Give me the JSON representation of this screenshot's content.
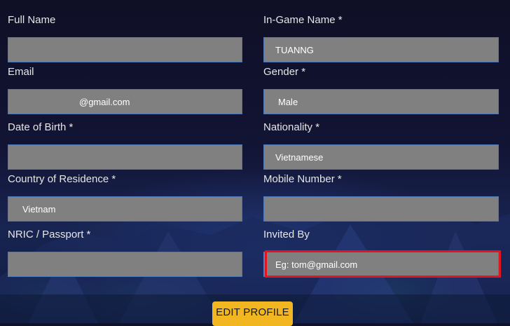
{
  "form": {
    "fields": [
      {
        "key": "full_name",
        "label": "Full Name",
        "value": ""
      },
      {
        "key": "ingame_name",
        "label": "In-Game Name *",
        "value": "TUANNG"
      },
      {
        "key": "email",
        "label": "Email",
        "value": "@gmail.com"
      },
      {
        "key": "gender",
        "label": "Gender *",
        "value": "Male"
      },
      {
        "key": "dob",
        "label": "Date of Birth *",
        "value": ""
      },
      {
        "key": "nationality",
        "label": "Nationality *",
        "value": "Vietnamese"
      },
      {
        "key": "country",
        "label": "Country of Residence *",
        "value": "Vietnam"
      },
      {
        "key": "mobile",
        "label": "Mobile Number *",
        "value": ""
      },
      {
        "key": "nric",
        "label": "NRIC / Passport *",
        "value": ""
      },
      {
        "key": "invited_by",
        "label": "Invited By",
        "value": "",
        "placeholder": "Eg: tom@gmail.com"
      }
    ],
    "submit_label": "EDIT PROFILE"
  },
  "colors": {
    "field_bg": "#808080",
    "field_border": "#4a78b8",
    "highlight": "#e3141e",
    "button_bg": "#f2b620"
  }
}
